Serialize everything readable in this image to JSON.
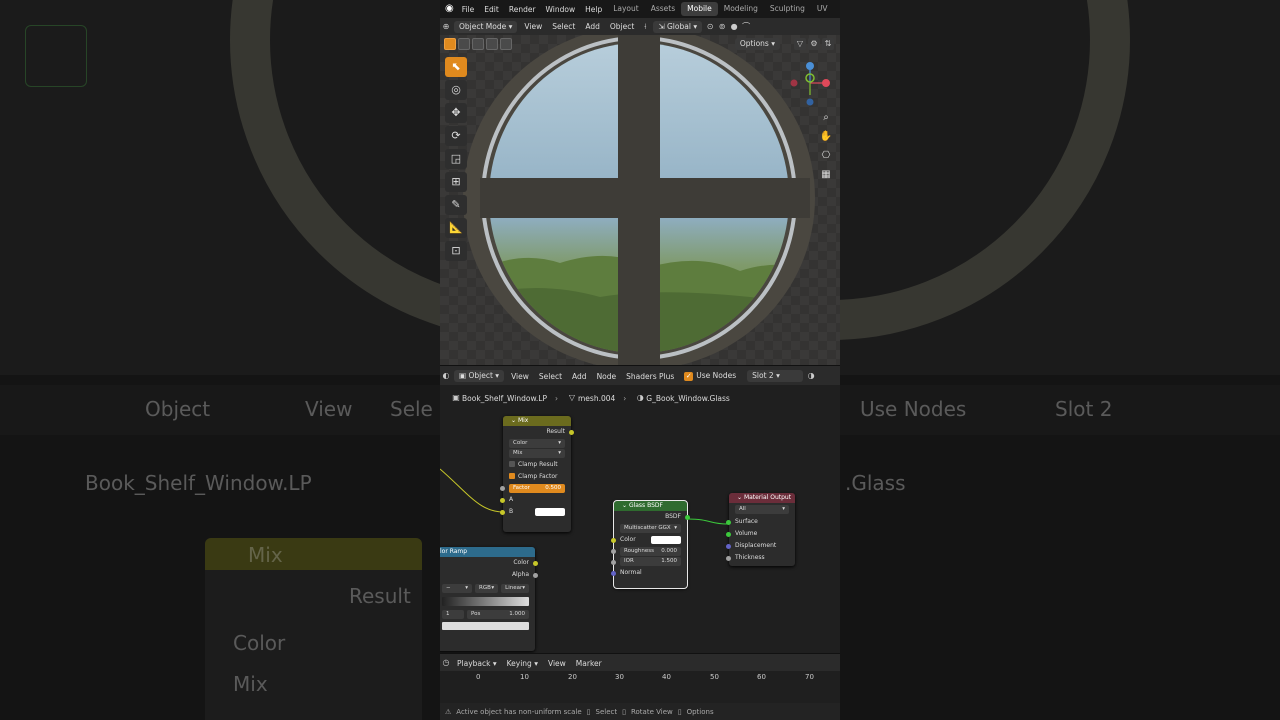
{
  "topbar": {
    "menus": [
      "File",
      "Edit",
      "Render",
      "Window",
      "Help"
    ],
    "workspaces": [
      "Layout",
      "Assets",
      "Mobile",
      "Modeling",
      "Sculpting",
      "UV Editing"
    ],
    "active_workspace": "Mobile"
  },
  "viewport_header": {
    "mode": "Object Mode",
    "menus": [
      "View",
      "Select",
      "Add",
      "Object"
    ],
    "transform_orientation": "Global",
    "options_label": "Options"
  },
  "viewport": {
    "tools": [
      "select-box",
      "cursor",
      "move",
      "rotate",
      "scale",
      "transform",
      "annotate",
      "measure",
      "add-cube"
    ],
    "active_tool": "select-box",
    "gizmo_axes": [
      "X",
      "Y",
      "Z"
    ]
  },
  "node_header": {
    "object_label": "Object",
    "menus": [
      "View",
      "Select",
      "Add",
      "Node",
      "Shaders Plus"
    ],
    "use_nodes_label": "Use Nodes",
    "slot_label": "Slot 2"
  },
  "breadcrumbs": {
    "object": "Book_Shelf_Window.LP",
    "mesh": "mesh.004",
    "material": "G_Book_Window.Glass"
  },
  "nodes": {
    "mix": {
      "title": "Mix",
      "result_label": "Result",
      "data_type": "Color",
      "blend_mode": "Mix",
      "clamp_result_label": "Clamp Result",
      "clamp_factor_label": "Clamp Factor",
      "factor_label": "Factor",
      "factor_value": "0.500",
      "a_label": "A",
      "b_label": "B"
    },
    "color_ramp": {
      "title": "lor Ramp",
      "color_label": "Color",
      "alpha_label": "Alpha",
      "mode": "RGB",
      "interpolation": "Linear",
      "pos_label": "Pos",
      "pos_value": "1.000"
    },
    "glass_bsdf": {
      "title": "Glass BSDF",
      "output_label": "BSDF",
      "distribution": "Multiscatter GGX",
      "color_label": "Color",
      "roughness_label": "Roughness",
      "roughness_value": "0.000",
      "ior_label": "IOR",
      "ior_value": "1.500",
      "normal_label": "Normal"
    },
    "material_output": {
      "title": "Material Output",
      "target": "All",
      "surface_label": "Surface",
      "volume_label": "Volume",
      "displacement_label": "Displacement",
      "thickness_label": "Thickness"
    }
  },
  "timeline_header": {
    "menus": [
      "Playback",
      "Keying",
      "View",
      "Marker"
    ]
  },
  "timeline": {
    "frames": [
      "0",
      "10",
      "20",
      "30",
      "40",
      "50",
      "60",
      "70"
    ]
  },
  "statusbar": {
    "warning": "Active object has non-uniform scale",
    "select": "Select",
    "rotate_view": "Rotate View",
    "options": "Options"
  },
  "background_zoom": {
    "object_label": "Object",
    "view_label": "View",
    "select_label": "Sele",
    "use_nodes_label": "Use Nodes",
    "slot_label": "Slot 2",
    "object_crumb": "Book_Shelf_Window.LP",
    "material_crumb": ".Glass",
    "mix_title": "Mix",
    "result_label": "Result",
    "color_label": "Color",
    "mix_label": "Mix"
  },
  "colors": {
    "accent": "#e08a1e",
    "mix_header": "#6b6b1e",
    "ramp_header": "#2d6b8c",
    "glass_header": "#2f6b2f",
    "output_header": "#6b2d3a"
  }
}
